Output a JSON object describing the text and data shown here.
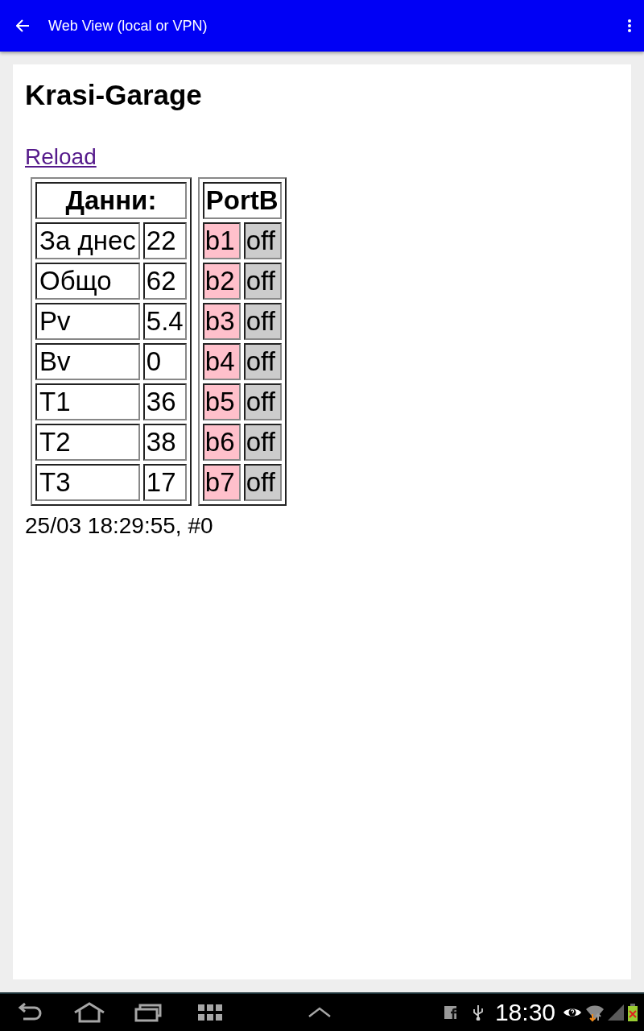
{
  "app_bar": {
    "title": "Web View (local or VPN)"
  },
  "page": {
    "heading": "Krasi-Garage",
    "link": "Reload",
    "data_table": {
      "header": "Данни:",
      "rows": [
        {
          "label": "За днес",
          "value": "22"
        },
        {
          "label": "Общо",
          "value": "62"
        },
        {
          "label": "Pv",
          "value": "5.4"
        },
        {
          "label": "Bv",
          "value": "0"
        },
        {
          "label": "T1",
          "value": "36"
        },
        {
          "label": "T2",
          "value": "38"
        },
        {
          "label": "T3",
          "value": "17"
        }
      ]
    },
    "port_table": {
      "header": "PortB",
      "rows": [
        {
          "pin": "b1",
          "state": "off"
        },
        {
          "pin": "b2",
          "state": "off"
        },
        {
          "pin": "b3",
          "state": "off"
        },
        {
          "pin": "b4",
          "state": "off"
        },
        {
          "pin": "b5",
          "state": "off"
        },
        {
          "pin": "b6",
          "state": "off"
        },
        {
          "pin": "b7",
          "state": "off"
        }
      ]
    },
    "timestamp": "25/03 18:29:55, #0"
  },
  "status_bar": {
    "time": "18:30"
  }
}
